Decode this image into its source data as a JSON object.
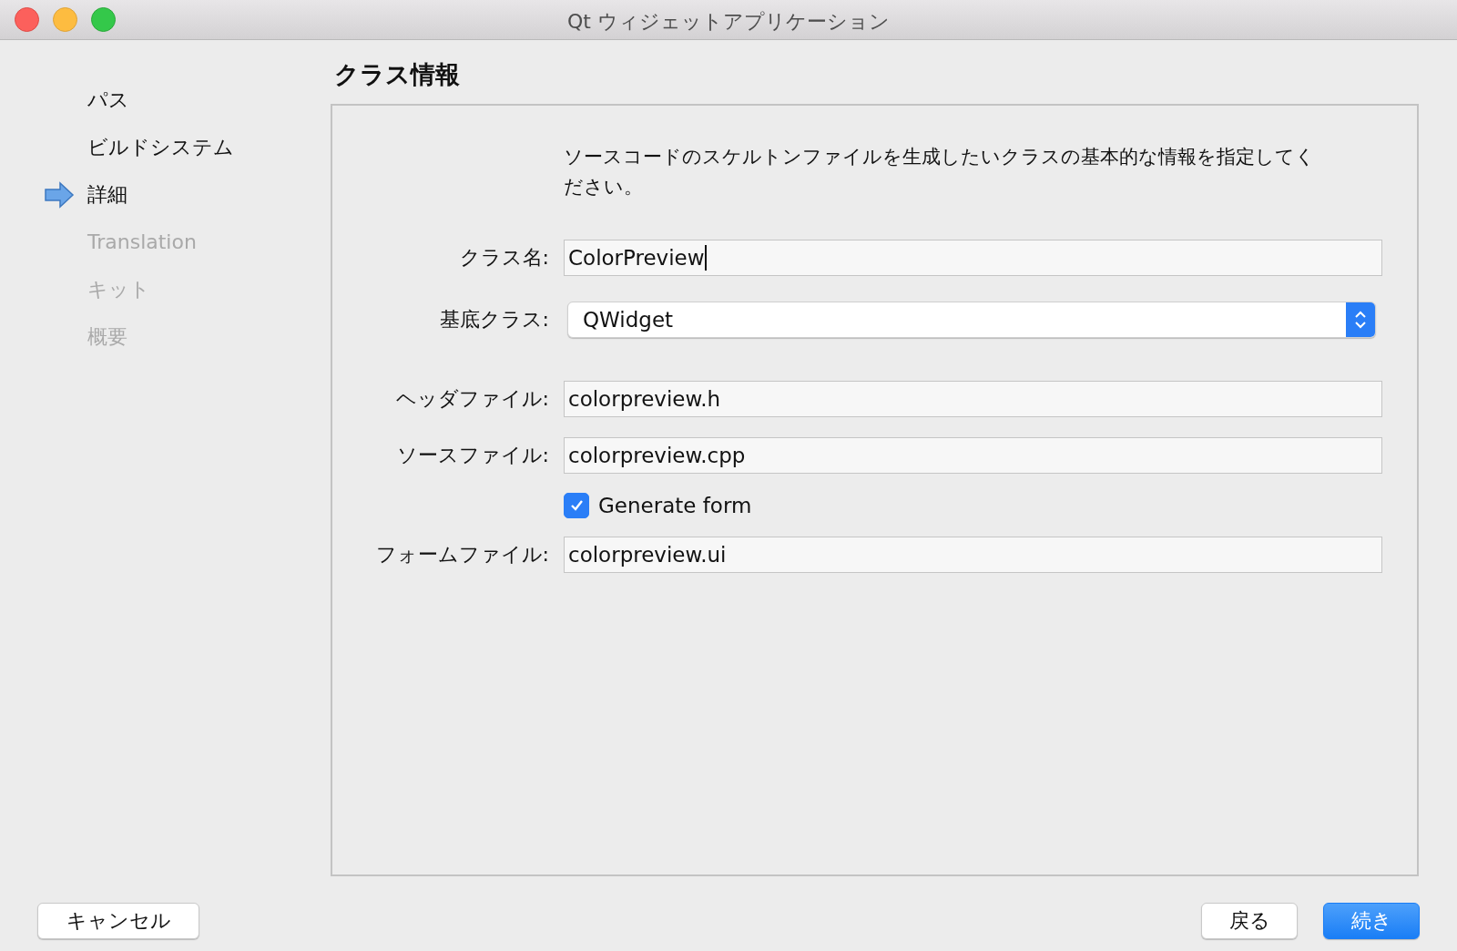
{
  "window": {
    "title": "Qt ウィジェットアプリケーション"
  },
  "sidebar": {
    "items": [
      {
        "label": "パス",
        "selected": false,
        "disabled": false
      },
      {
        "label": "ビルドシステム",
        "selected": false,
        "disabled": false
      },
      {
        "label": "詳細",
        "selected": true,
        "disabled": false
      },
      {
        "label": "Translation",
        "selected": false,
        "disabled": true
      },
      {
        "label": "キット",
        "selected": false,
        "disabled": true
      },
      {
        "label": "概要",
        "selected": false,
        "disabled": true
      }
    ]
  },
  "page": {
    "title": "クラス情報",
    "description": "ソースコードのスケルトンファイルを生成したいクラスの基本的な情報を指定してください。",
    "fields": [
      {
        "kind": "text",
        "label": "クラス名:",
        "value": "ColorPreview",
        "focused": true
      },
      {
        "kind": "combo",
        "label": "基底クラス:",
        "value": "QWidget"
      },
      {
        "kind": "text",
        "label": "ヘッダファイル:",
        "value": "colorpreview.h",
        "focused": false
      },
      {
        "kind": "text",
        "label": "ソースファイル:",
        "value": "colorpreview.cpp",
        "focused": false
      },
      {
        "kind": "checkbox",
        "label": "Generate form",
        "checked": true
      },
      {
        "kind": "text",
        "label": "フォームファイル:",
        "value": "colorpreview.ui",
        "focused": false
      }
    ]
  },
  "buttons": {
    "cancel": "キャンセル",
    "back": "戻る",
    "next": "続き"
  }
}
